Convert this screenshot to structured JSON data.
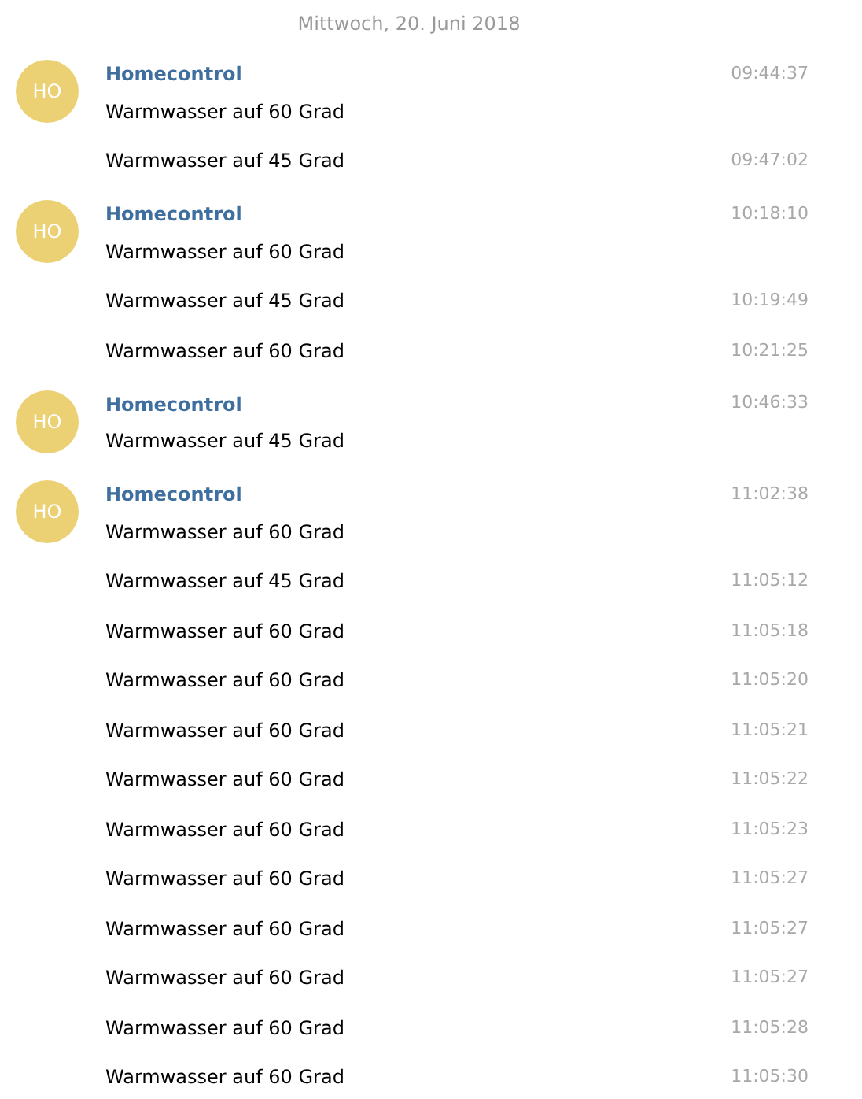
{
  "date_separator": "Mittwoch, 20. Juni 2018",
  "groups": [
    {
      "sender": "Homecontrol",
      "avatar": "HO",
      "messages": [
        {
          "text": "Warmwasser auf 60 Grad",
          "time": "09:44:37"
        },
        {
          "text": "Warmwasser auf 45 Grad",
          "time": "09:47:02"
        }
      ]
    },
    {
      "sender": "Homecontrol",
      "avatar": "HO",
      "messages": [
        {
          "text": "Warmwasser auf 60 Grad",
          "time": "10:18:10"
        },
        {
          "text": "Warmwasser auf 45 Grad",
          "time": "10:19:49"
        },
        {
          "text": "Warmwasser auf 60 Grad",
          "time": "10:21:25"
        }
      ]
    },
    {
      "sender": "Homecontrol",
      "avatar": "HO",
      "messages": [
        {
          "text": "Warmwasser auf 45 Grad",
          "time": "10:46:33"
        }
      ]
    },
    {
      "sender": "Homecontrol",
      "avatar": "HO",
      "messages": [
        {
          "text": "Warmwasser auf 60 Grad",
          "time": "11:02:38"
        },
        {
          "text": "Warmwasser auf 45 Grad",
          "time": "11:05:12"
        },
        {
          "text": "Warmwasser auf 60 Grad",
          "time": "11:05:18"
        },
        {
          "text": "Warmwasser auf 60 Grad",
          "time": "11:05:20"
        },
        {
          "text": "Warmwasser auf 60 Grad",
          "time": "11:05:21"
        },
        {
          "text": "Warmwasser auf 60 Grad",
          "time": "11:05:22"
        },
        {
          "text": "Warmwasser auf 60 Grad",
          "time": "11:05:23"
        },
        {
          "text": "Warmwasser auf 60 Grad",
          "time": "11:05:27"
        },
        {
          "text": "Warmwasser auf 60 Grad",
          "time": "11:05:27"
        },
        {
          "text": "Warmwasser auf 60 Grad",
          "time": "11:05:27"
        },
        {
          "text": "Warmwasser auf 60 Grad",
          "time": "11:05:28"
        },
        {
          "text": "Warmwasser auf 60 Grad",
          "time": "11:05:30"
        }
      ]
    }
  ]
}
